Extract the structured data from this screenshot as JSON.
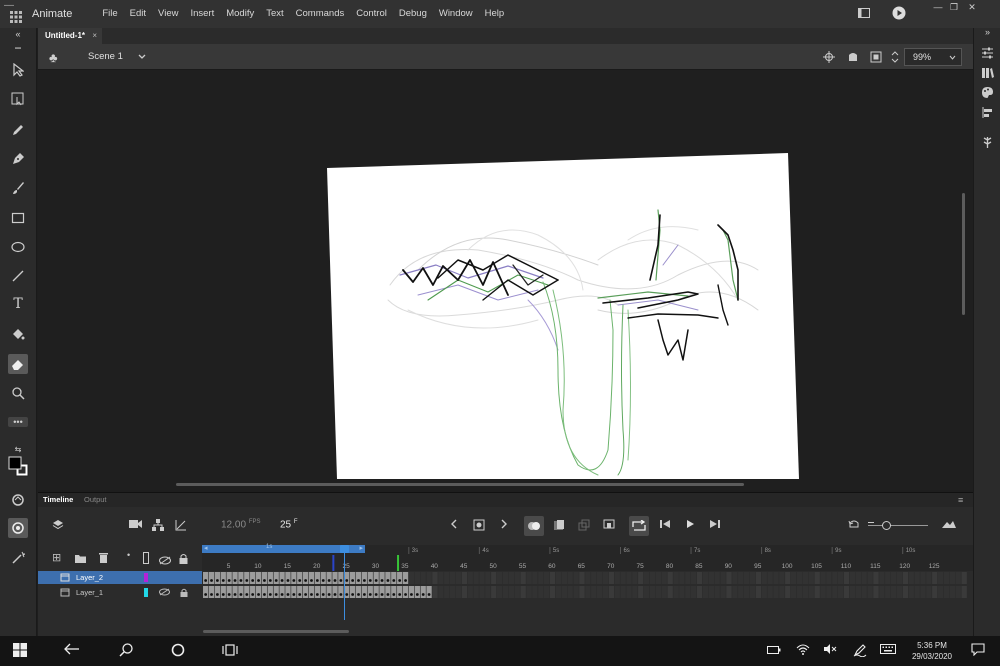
{
  "app": {
    "name": "Animate",
    "menu": [
      "File",
      "Edit",
      "View",
      "Insert",
      "Modify",
      "Text",
      "Commands",
      "Control",
      "Debug",
      "Window",
      "Help"
    ]
  },
  "document": {
    "tab_title": "Untitled-1*",
    "scene": "Scene 1",
    "zoom": "99%"
  },
  "timeline": {
    "tabs": [
      "Timeline",
      "Output"
    ],
    "fps_value": "12.00",
    "fps_unit": "FPS",
    "frame_value": "25",
    "frame_unit": "F",
    "span_label": "1s",
    "frame_ticks": [
      "5",
      "10",
      "15",
      "20",
      "25",
      "30",
      "35",
      "40",
      "45",
      "50",
      "55",
      "60",
      "65",
      "70",
      "75",
      "80",
      "85",
      "90",
      "95",
      "100",
      "105",
      "110",
      "115",
      "120",
      "125"
    ],
    "second_ticks": [
      "3s",
      "4s",
      "5s",
      "6s",
      "7s",
      "8s",
      "9s",
      "10s"
    ],
    "current_frame": 25,
    "layer2_frames": 35,
    "layer1_frames": 39,
    "layers": [
      {
        "name": "Layer_2",
        "color": "#b522d8",
        "selected": true
      },
      {
        "name": "Layer_1",
        "color": "#22d8e8",
        "selected": false
      }
    ]
  },
  "taskbar": {
    "time": "5:36 PM",
    "date": "29/03/2020"
  },
  "colors": {
    "accent": "#3d7bc4",
    "stage": "#ffffff",
    "playhead": "#3d8ee0"
  }
}
